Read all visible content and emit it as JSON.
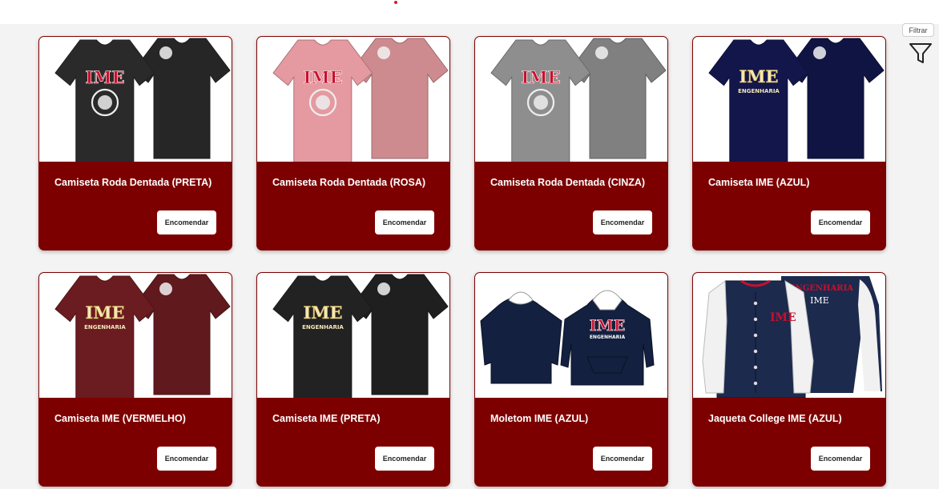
{
  "toolbar": {
    "filter_label": "Filtrar"
  },
  "products": [
    {
      "title": "Camiseta Roda Dentada (PRETA)",
      "button": "Encomendar",
      "kind": "tshirt-seal",
      "garment_color": "#2a2a2a",
      "logo_text": "IME",
      "logo_color": "#c8102e"
    },
    {
      "title": "Camiseta Roda Dentada (ROSA)",
      "button": "Encomendar",
      "kind": "tshirt-seal",
      "garment_color": "#e49aa0",
      "logo_text": "IME",
      "logo_color": "#c8102e"
    },
    {
      "title": "Camiseta Roda Dentada (CINZA)",
      "button": "Encomendar",
      "kind": "tshirt-seal",
      "garment_color": "#8e8e8e",
      "logo_text": "IME",
      "logo_color": "#c8102e"
    },
    {
      "title": "Camiseta IME (AZUL)",
      "button": "Encomendar",
      "kind": "tshirt-text",
      "garment_color": "#12164a",
      "logo_text": "IME",
      "logo_color": "#f3e7b8",
      "sub_text": "ENGENHARIA"
    },
    {
      "title": "Camiseta IME (VERMELHO)",
      "button": "Encomendar",
      "kind": "tshirt-text",
      "garment_color": "#6b1c20",
      "logo_text": "IME",
      "logo_color": "#f3e7b8",
      "sub_text": "ENGENHARIA"
    },
    {
      "title": "Camiseta IME (PRETA)",
      "button": "Encomendar",
      "kind": "tshirt-text",
      "garment_color": "#222222",
      "logo_text": "IME",
      "logo_color": "#f3e7b8",
      "sub_text": "ENGENHARIA"
    },
    {
      "title": "Moletom IME (AZUL)",
      "button": "Encomendar",
      "kind": "hoodie",
      "garment_color": "#13203f",
      "logo_text": "IME",
      "logo_color": "#c8102e",
      "sub_text": "ENGENHARIA"
    },
    {
      "title": "Jaqueta College IME (AZUL)",
      "button": "Encomendar",
      "kind": "jacket",
      "garment_color": "#1c2a4d",
      "logo_text": "IME",
      "logo_color": "#c8102e",
      "sub_text": "ENGENHARIA"
    }
  ],
  "colors": {
    "card_bg": "#7d0000",
    "page_bg": "#f4f3f3"
  }
}
